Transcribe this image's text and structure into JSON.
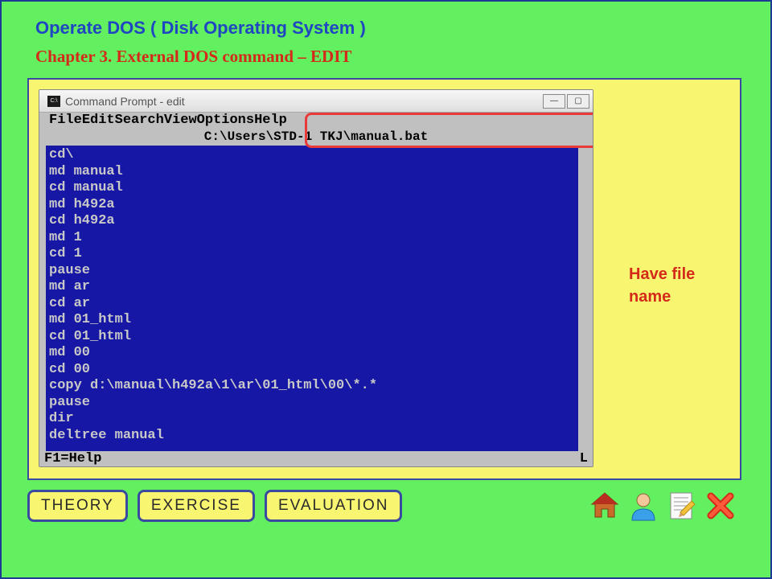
{
  "title": "Operate DOS ( Disk Operating System )",
  "chapter": "Chapter 3.   External DOS command – EDIT",
  "cmd": {
    "windowTitle": "Command Prompt - edit",
    "menus": {
      "file": "File",
      "edit": "Edit",
      "search": "Search",
      "view": "View",
      "options": "Options",
      "help": "Help"
    },
    "filepath": "C:\\Users\\STD-1 TKJ\\manual.bat",
    "lines": [
      "cd\\",
      "md manual",
      "cd manual",
      "md h492a",
      "cd h492a",
      "md 1",
      "cd 1",
      "pause",
      "md ar",
      "cd ar",
      "md 01_html",
      "cd 01_html",
      "md 00",
      "cd 00",
      "copy d:\\manual\\h492a\\1\\ar\\01_html\\00\\*.*",
      "pause",
      "dir",
      "deltree manual"
    ],
    "statusLeft": "F1=Help",
    "statusRight": "L"
  },
  "annotation": "Have file name",
  "buttons": {
    "theory": "Theory",
    "exercise": "Exercise",
    "evaluation": "Evaluation"
  }
}
